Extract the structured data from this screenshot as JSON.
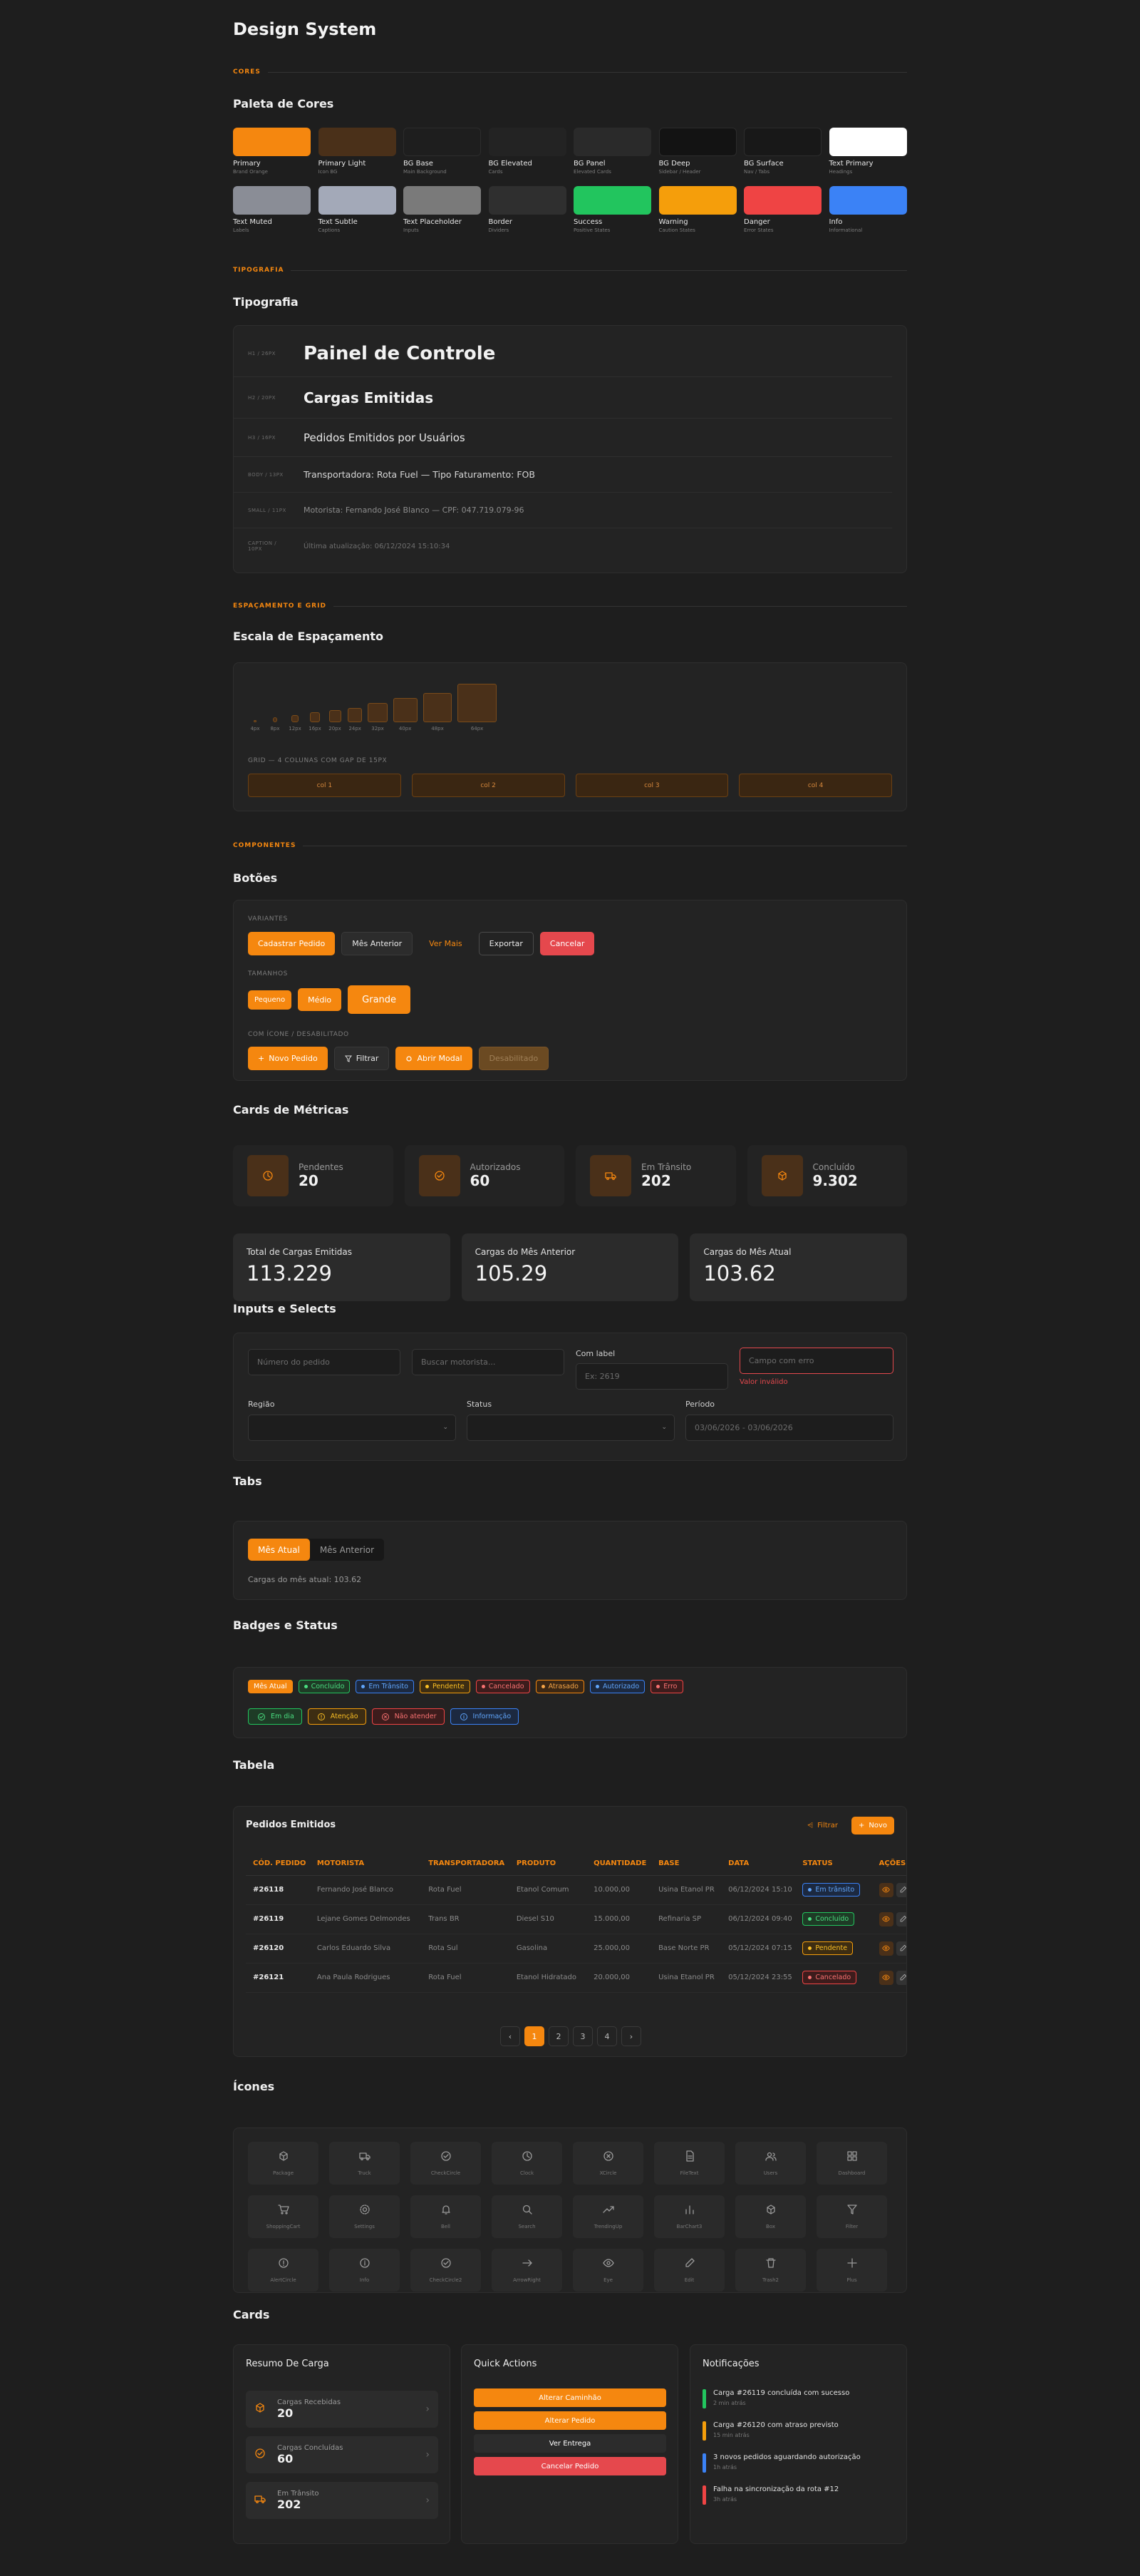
{
  "page": {
    "title": "Design System"
  },
  "colors": {
    "section": "CORES",
    "title": "Paleta de Cores",
    "swatches": [
      {
        "name": "Primary",
        "desc": "Brand Orange",
        "hex": "#f5870f"
      },
      {
        "name": "Primary Light",
        "desc": "Icon BG",
        "hex": "#4a3019"
      },
      {
        "name": "BG Base",
        "desc": "Main Background",
        "hex": "#1e1e1e"
      },
      {
        "name": "BG Elevated",
        "desc": "Cards",
        "hex": "#232323"
      },
      {
        "name": "BG Panel",
        "desc": "Elevated Cards",
        "hex": "#2a2a2a"
      },
      {
        "name": "BG Deep",
        "desc": "Sidebar / Header",
        "hex": "#131313"
      },
      {
        "name": "BG Surface",
        "desc": "Nav / Tabs",
        "hex": "#181818"
      },
      {
        "name": "Text Primary",
        "desc": "Headings",
        "hex": "#ffffff"
      },
      {
        "name": "Text Muted",
        "desc": "Labels",
        "hex": "#8a8d96"
      },
      {
        "name": "Text Subtle",
        "desc": "Captions",
        "hex": "#a3a9b8"
      },
      {
        "name": "Text Placeholder",
        "desc": "Inputs",
        "hex": "#7a7a7a"
      },
      {
        "name": "Border",
        "desc": "Dividers",
        "hex": "#2f2f2f"
      },
      {
        "name": "Success",
        "desc": "Positive States",
        "hex": "#22c55e"
      },
      {
        "name": "Warning",
        "desc": "Caution States",
        "hex": "#f59e0b"
      },
      {
        "name": "Danger",
        "desc": "Error States",
        "hex": "#ef4444"
      },
      {
        "name": "Info",
        "desc": "Informational",
        "hex": "#3b82f6"
      }
    ]
  },
  "typography": {
    "section": "TIPOGRAFIA",
    "title": "Tipografia",
    "rows": [
      {
        "label": "H1 / 26PX",
        "text": "Painel de Controle"
      },
      {
        "label": "H2 / 20PX",
        "text": "Cargas Emitidas"
      },
      {
        "label": "H3 / 16PX",
        "text": "Pedidos Emitidos por Usuários"
      },
      {
        "label": "BODY / 13PX",
        "text": "Transportadora: Rota Fuel — Tipo Faturamento: FOB"
      },
      {
        "label": "SMALL / 11PX",
        "text": "Motorista: Fernando José Blanco — CPF: 047.719.079-96"
      },
      {
        "label": "CAPTION / 10PX",
        "text": "Última atualização: 06/12/2024 15:10:34"
      }
    ]
  },
  "spacing": {
    "section": "ESPAÇAMENTO E GRID",
    "title": "Escala de Espaçamento",
    "labels": [
      "4px",
      "8px",
      "12px",
      "16px",
      "20px",
      "24px",
      "32px",
      "40px",
      "48px",
      "64px"
    ],
    "grid_label": "GRID — 4 COLUNAS COM GAP DE 15PX",
    "cols": [
      "col 1",
      "col 2",
      "col 3",
      "col 4"
    ]
  },
  "components": {
    "section": "COMPONENTES"
  },
  "buttons": {
    "title": "Botões",
    "variants_label": "VARIANTES",
    "variants": [
      "Cadastrar Pedido",
      "Mês Anterior",
      "Ver Mais",
      "Exportar",
      "Cancelar"
    ],
    "sizes_label": "TAMANHOS",
    "sizes": [
      "Pequeno",
      "Médio",
      "Grande"
    ],
    "icon_label": "COM ÍCONE / DESABILITADO",
    "icon_buttons": [
      "Novo Pedido",
      "Filtrar",
      "Abrir Modal",
      "Desabilitado"
    ]
  },
  "metrics": {
    "title": "Cards de Métricas",
    "cards": [
      {
        "label": "Pendentes",
        "value": "20"
      },
      {
        "label": "Autorizados",
        "value": "60"
      },
      {
        "label": "Em Trânsito",
        "value": "202"
      },
      {
        "label": "Concluído",
        "value": "9.302"
      }
    ],
    "big": [
      {
        "label": "Total de Cargas Emitidas",
        "value": "113.229"
      },
      {
        "label": "Cargas do Mês Anterior",
        "value": "105.29"
      },
      {
        "label": "Cargas do Mês Atual",
        "value": "103.62"
      }
    ]
  },
  "inputs": {
    "title": "Inputs e Selects",
    "p1": "Número do pedido",
    "p2": "Buscar motorista...",
    "label3": "Com label",
    "p3": "Ex: 2619",
    "p4": "Campo com erro",
    "error": "Valor inválido",
    "region": "Região",
    "status": "Status",
    "period": "Período",
    "period_value": "03/06/2026 - 03/06/2026"
  },
  "tabs": {
    "title": "Tabs",
    "items": [
      "Mês Atual",
      "Mês Anterior"
    ],
    "content": "Cargas do mês atual: 103.62"
  },
  "badges": {
    "title": "Badges e Status",
    "row1": [
      "Mês Atual",
      "Concluído",
      "Em Trânsito",
      "Pendente",
      "Cancelado",
      "Atrasado",
      "Autorizado",
      "Erro"
    ],
    "row2": [
      "Em dia",
      "Atenção",
      "Não atender",
      "Informação"
    ]
  },
  "table": {
    "title": "Tabela",
    "card_title": "Pedidos Emitidos",
    "filter": "Filtrar",
    "new": "Novo",
    "headers": [
      "CÓD. PEDIDO",
      "MOTORISTA",
      "TRANSPORTADORA",
      "PRODUTO",
      "QUANTIDADE",
      "BASE",
      "DATA",
      "STATUS",
      "AÇÕES"
    ],
    "rows": [
      [
        "#26118",
        "Fernando José Blanco",
        "Rota Fuel",
        "Etanol Comum",
        "10.000,00",
        "Usina Etanol PR",
        "06/12/2024 15:10",
        "Em trânsito"
      ],
      [
        "#26119",
        "Lejane Gomes Delmondes",
        "Trans BR",
        "Diesel S10",
        "15.000,00",
        "Refinaria SP",
        "06/12/2024 09:40",
        "Concluído"
      ],
      [
        "#26120",
        "Carlos Eduardo Silva",
        "Rota Sul",
        "Gasolina",
        "25.000,00",
        "Base Norte PR",
        "05/12/2024 07:15",
        "Pendente"
      ],
      [
        "#26121",
        "Ana Paula Rodrigues",
        "Rota Fuel",
        "Etanol Hidratado",
        "20.000,00",
        "Usina Etanol PR",
        "05/12/2024 23:55",
        "Cancelado"
      ]
    ],
    "pages": [
      "‹",
      "1",
      "2",
      "3",
      "4",
      "›"
    ]
  },
  "icons": {
    "title": "Ícones",
    "items": [
      "Package",
      "Truck",
      "CheckCircle",
      "Clock",
      "XCircle",
      "FileText",
      "Users",
      "Dashboard",
      "ShoppingCart",
      "Settings",
      "Bell",
      "Search",
      "TrendingUp",
      "BarChart3",
      "Box",
      "Filter",
      "AlertCircle",
      "Info",
      "CheckCircle2",
      "ArrowRight",
      "Eye",
      "Edit",
      "Trash2",
      "Plus"
    ]
  },
  "cards": {
    "title": "Cards",
    "summary_title": "Resumo De Carga",
    "summary": [
      {
        "label": "Cargas Recebidas",
        "value": "20"
      },
      {
        "label": "Cargas Concluídas",
        "value": "60"
      },
      {
        "label": "Em Trânsito",
        "value": "202"
      }
    ],
    "qa_title": "Quick Actions",
    "qa": [
      "Alterar Caminhão",
      "Alterar Pedido",
      "Ver Entrega",
      "Cancelar Pedido"
    ],
    "notif_title": "Notificações",
    "notifs": [
      {
        "text": "Carga #26119 concluída com sucesso",
        "time": "2 min atrás",
        "color": "#22c55e"
      },
      {
        "text": "Carga #26120 com atraso previsto",
        "time": "15 min atrás",
        "color": "#f59e0b"
      },
      {
        "text": "3 novos pedidos aguardando autorização",
        "time": "1h atrás",
        "color": "#3b82f6"
      },
      {
        "text": "Falha na sincronização da rota #12",
        "time": "3h atrás",
        "color": "#ef4444"
      }
    ]
  }
}
